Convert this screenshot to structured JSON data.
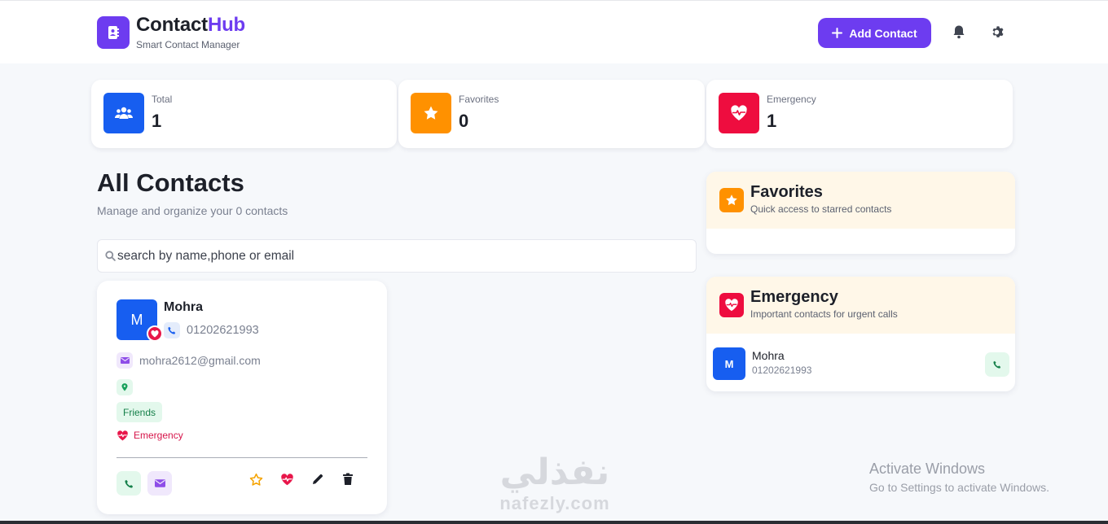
{
  "header": {
    "brand_part1": "Contact",
    "brand_part2": "Hub",
    "tagline": "Smart Contact Manager",
    "add_button_label": "Add Contact",
    "colors": {
      "brand": "#6d3cf0"
    }
  },
  "stats": [
    {
      "label": "Total",
      "value": "1",
      "icon": "users-icon",
      "color": "#175ef0"
    },
    {
      "label": "Favorites",
      "value": "0",
      "icon": "star-icon",
      "color": "#ff9100"
    },
    {
      "label": "Emergency",
      "value": "1",
      "icon": "heart-pulse-icon",
      "color": "#ee0d3f"
    }
  ],
  "main": {
    "title": "All Contacts",
    "subtitle": "Manage and organize your 0 contacts",
    "search_placeholder": "search by name,phone or email"
  },
  "contact_card": {
    "initial": "M",
    "name": "Mohra",
    "phone": "01202621993",
    "email": "mohra2612@gmail.com",
    "tag": "Friends",
    "emergency_label": "Emergency"
  },
  "favorites_panel": {
    "title": "Favorites",
    "subtitle": "Quick access to starred contacts"
  },
  "emergency_panel": {
    "title": "Emergency",
    "subtitle": "Important contacts for urgent calls",
    "contacts": [
      {
        "initial": "M",
        "name": "Mohra",
        "phone": "01202621993"
      }
    ]
  },
  "watermark": {
    "activate_title": "Activate Windows",
    "activate_sub": "Go to Settings to activate Windows.",
    "site_arabic": "نفذلي",
    "site_latin": "nafezly.com"
  }
}
